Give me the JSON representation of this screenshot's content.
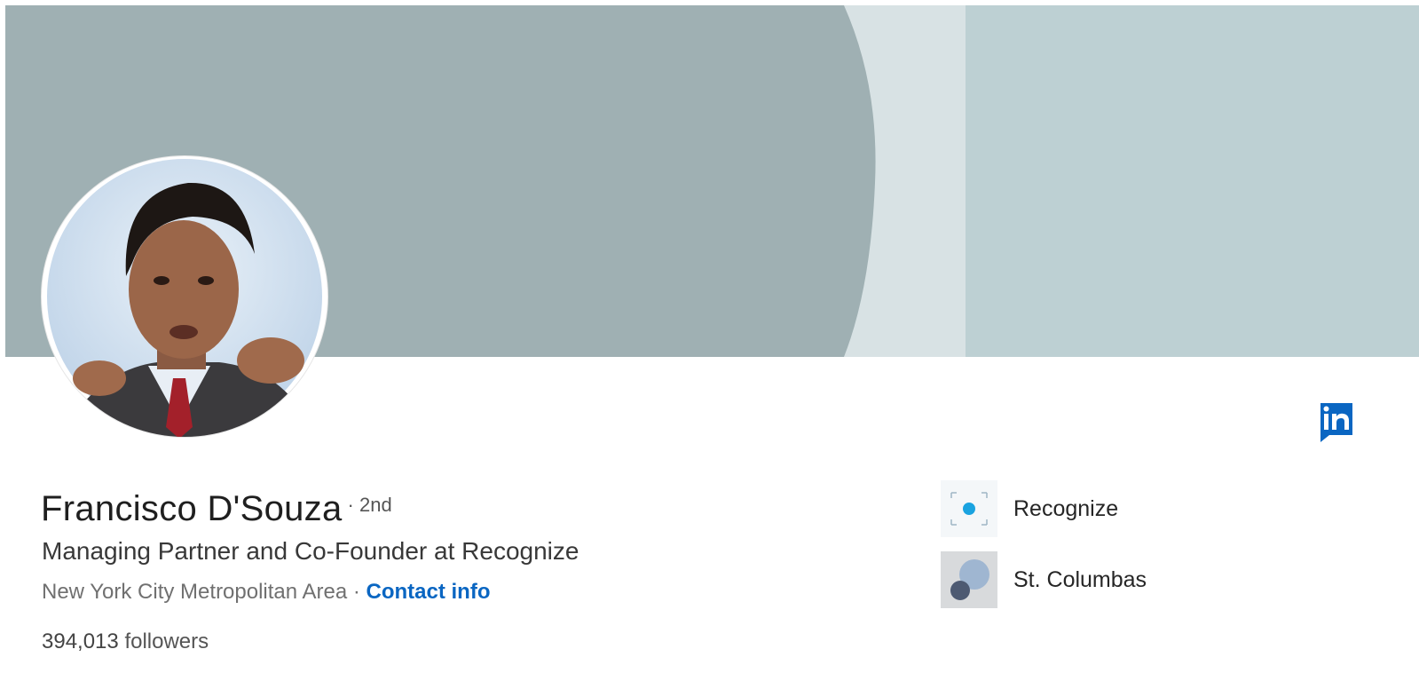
{
  "profile": {
    "name": "Francisco D'Souza",
    "degree": "· 2nd",
    "headline": "Managing Partner and Co-Founder at Recognize",
    "location": "New York City Metropolitan Area",
    "separator": "·",
    "contact_info_label": "Contact info",
    "followers_count": "394,013",
    "followers_label": "followers"
  },
  "organizations": [
    {
      "name": "Recognize",
      "icon": "recognize-logo-icon"
    },
    {
      "name": "St. Columbas",
      "icon": "st-columbas-logo-icon"
    }
  ],
  "icons": {
    "linkedin": "linkedin-icon",
    "avatar": "profile-photo"
  },
  "colors": {
    "banner_dark": "#9fb0b3",
    "banner_light": "#d8e2e4",
    "banner_right": "#bdd0d3",
    "link_blue": "#0a66c2",
    "linkedin_blue": "#0a66c2"
  }
}
